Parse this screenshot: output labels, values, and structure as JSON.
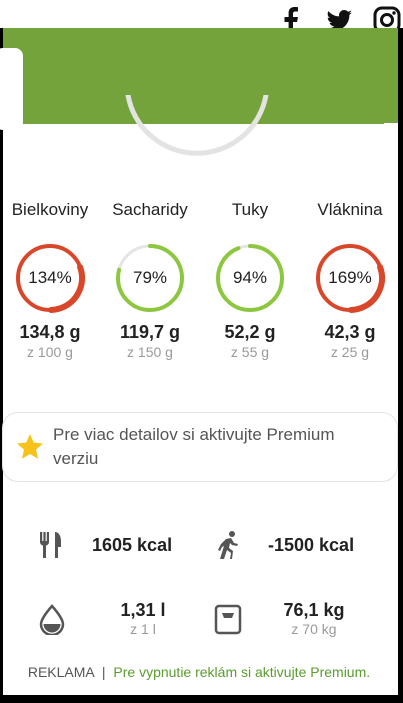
{
  "social": {
    "icons": [
      "facebook-icon",
      "twitter-icon",
      "instagram-icon"
    ]
  },
  "colors": {
    "header": "#74a33b",
    "over": "#d9472b",
    "ok": "#8dc63f",
    "track": "#e5e5e5"
  },
  "macros": [
    {
      "name": "Bielkoviny",
      "pct": "134%",
      "value": "134,8 g",
      "goal": "z 100 g",
      "fraction": 1.0,
      "state": "over"
    },
    {
      "name": "Sacharidy",
      "pct": "79%",
      "value": "119,7 g",
      "goal": "z 150 g",
      "fraction": 0.79,
      "state": "ok"
    },
    {
      "name": "Tuky",
      "pct": "94%",
      "value": "52,2 g",
      "goal": "z 55 g",
      "fraction": 0.94,
      "state": "ok"
    },
    {
      "name": "Vláknina",
      "pct": "169%",
      "value": "42,3 g",
      "goal": "z 25 g",
      "fraction": 1.0,
      "state": "over"
    }
  ],
  "premium": {
    "text": "Pre viac detailov si aktivujte Premium verziu"
  },
  "stats": {
    "food": {
      "value": "1605 kcal"
    },
    "activity": {
      "value": "-1500 kcal"
    },
    "water": {
      "value": "1,31 l",
      "goal": "z 1 l"
    },
    "weight": {
      "value": "76,1 kg",
      "goal": "z 70 kg"
    }
  },
  "ad": {
    "label": "REKLAMA",
    "separator": "|",
    "link": "Pre vypnutie reklám si aktivujte Premium."
  }
}
